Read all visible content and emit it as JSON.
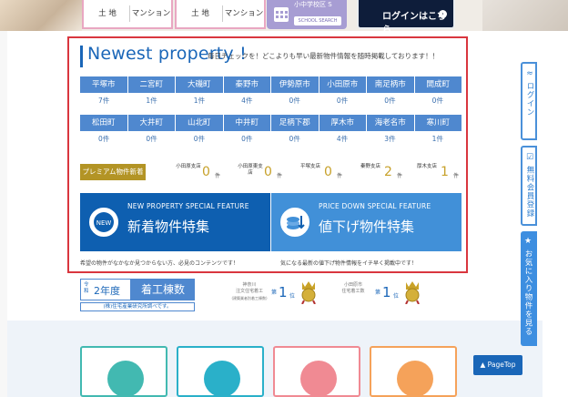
{
  "top": {
    "cards": [
      {
        "left": "土 地",
        "right": "マンション"
      },
      {
        "left": "土 地",
        "right": "マンション"
      }
    ],
    "school": {
      "top_cut": "小中学校区 S",
      "label": "SCHOOL SEARCH"
    },
    "login": {
      "label": "ログインはこちら"
    }
  },
  "newest": {
    "title": "Newest property !",
    "subtitle": "毎日チェックを！どこよりも早い最新物件情報を随時掲載しております！！",
    "rows": [
      {
        "areas": [
          "平塚市",
          "二宮町",
          "大磯町",
          "秦野市",
          "伊勢原市",
          "小田原市",
          "南足柄市",
          "開成町"
        ],
        "counts": [
          "7件",
          "1件",
          "1件",
          "4件",
          "0件",
          "0件",
          "0件",
          "0件"
        ]
      },
      {
        "areas": [
          "松田町",
          "大井町",
          "山北町",
          "中井町",
          "足柄下郡",
          "厚木市",
          "海老名市",
          "寒川町"
        ],
        "counts": [
          "0件",
          "0件",
          "0件",
          "0件",
          "0件",
          "4件",
          "3件",
          "1件"
        ]
      }
    ],
    "premium": {
      "label": "プレミアム物件新着情報",
      "branches": [
        {
          "name": "小田原支店",
          "count": "0",
          "unit": "件"
        },
        {
          "name": "小田原東支店",
          "count": "0",
          "unit": "件"
        },
        {
          "name": "平塚支店",
          "count": "0",
          "unit": "件"
        },
        {
          "name": "秦野支店",
          "count": "2",
          "unit": "件"
        },
        {
          "name": "厚木支店",
          "count": "1",
          "unit": "件"
        }
      ]
    },
    "features": [
      {
        "en": "NEW PROPERTY SPECIAL FEATURE",
        "ja": "新着物件特集",
        "caption": "希望の物件がなかなか見つからない方、必見のコンテンツです！",
        "badge": "NEW"
      },
      {
        "en": "PRICE DOWN SPECIAL FEATURE",
        "ja": "値下げ物件特集",
        "caption": "気になる最新の値下げ物件情報をイチ早く掲載中です！"
      }
    ]
  },
  "banners": {
    "year": {
      "reiwa": "令和",
      "year": "2年度",
      "count": "着工棟数",
      "note": "(株)住宅産業研究所調べです。"
    },
    "ranks": [
      {
        "label1": "神奈川",
        "label2": "注文住宅着工",
        "small": "(建築業者別着工棟数)",
        "pre": "第",
        "num": "1",
        "post": "位"
      },
      {
        "label1": "小田原市",
        "label2": "住宅着工数",
        "small": "",
        "pre": "第",
        "num": "1",
        "post": "位"
      }
    ]
  },
  "side": {
    "login": "ログイン",
    "free": "無料会員登録",
    "fav": "お気に入り物件を見る"
  },
  "pagetop": "PageTop",
  "colors": {
    "frame": "#d9363e",
    "header_blue": "#4f88cf",
    "brand_blue": "#1a66b8",
    "premium_gold": "#b39425",
    "tile_green": "#42b9b1",
    "tile_teal": "#2ab0c9",
    "tile_pink": "#f08a93",
    "tile_orange": "#f5a25a"
  }
}
